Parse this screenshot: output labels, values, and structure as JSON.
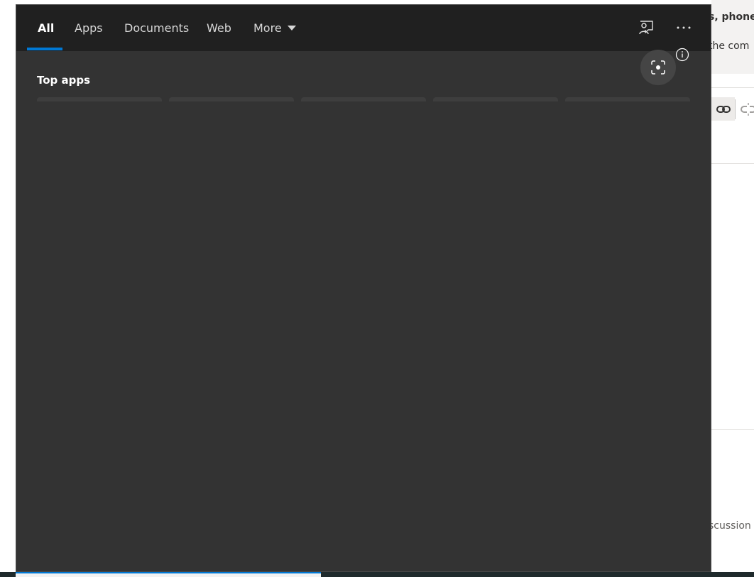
{
  "background_page": {
    "text_top": "s, phone",
    "text_second": "the com",
    "text_bottom": "scussion",
    "toolbar_icons": [
      "link-icon",
      "unlink-icon"
    ]
  },
  "search_panel": {
    "tabs": [
      {
        "label": "All",
        "selected": true
      },
      {
        "label": "Apps",
        "selected": false
      },
      {
        "label": "Documents",
        "selected": false
      },
      {
        "label": "Web",
        "selected": false
      },
      {
        "label": "More",
        "selected": false
      }
    ],
    "header_icons": [
      "feedback-icon",
      "more-options-icon"
    ],
    "top_apps": {
      "title": "Top apps",
      "tile_count": 5
    },
    "visual_search_icon": "visual-search-icon",
    "info_icon": "info-icon"
  },
  "colors": {
    "panel_bg": "#333333",
    "header_bg": "#202020",
    "accent": "#0078d4",
    "taskbar": "#1f2a2c"
  }
}
